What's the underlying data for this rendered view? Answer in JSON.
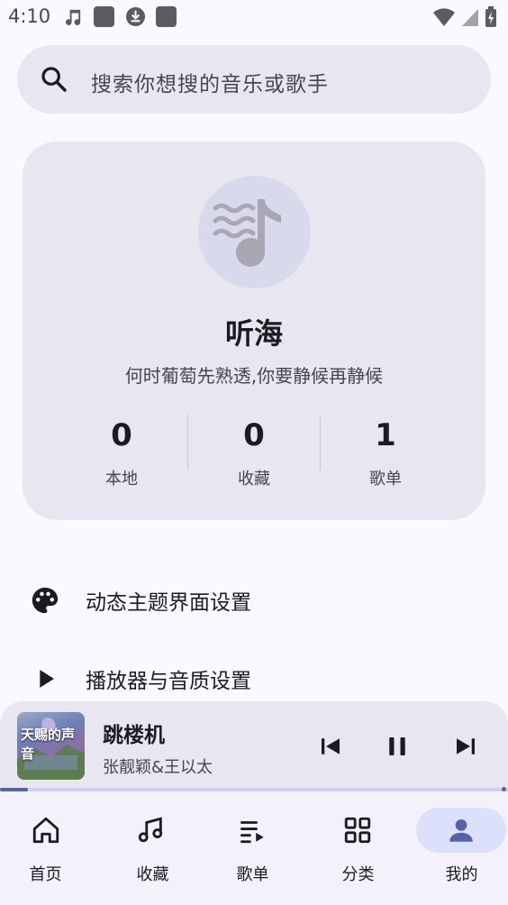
{
  "status_bar": {
    "time": "4:10",
    "left_icons": [
      "music-note-icon",
      "app-square-icon",
      "download-icon",
      "app-square-icon"
    ],
    "right_icons": [
      "wifi-icon",
      "cell-signal-icon",
      "battery-charging-icon"
    ]
  },
  "search": {
    "placeholder": "搜索你想搜的音乐或歌手",
    "icon": "search-icon"
  },
  "profile": {
    "name": "听海",
    "signature": "何时葡萄先熟透,你要静候再静候",
    "avatar_icon": "music-waves-icon",
    "stats": [
      {
        "value": "0",
        "label": "本地"
      },
      {
        "value": "0",
        "label": "收藏"
      },
      {
        "value": "1",
        "label": "歌单"
      }
    ]
  },
  "settings": [
    {
      "icon": "palette-icon",
      "label": "动态主题界面设置"
    },
    {
      "icon": "play-icon",
      "label": "播放器与音质设置"
    }
  ],
  "player": {
    "cover_text": "天赐的声音",
    "title": "跳楼机",
    "artist": "张靓颖&王以太",
    "progress": 0.055,
    "controls": [
      "skip-previous-icon",
      "pause-icon",
      "skip-next-icon"
    ]
  },
  "bottom_nav": {
    "active_index": 4,
    "items": [
      {
        "icon": "home-icon",
        "label": "首页"
      },
      {
        "icon": "music-note-icon",
        "label": "收藏"
      },
      {
        "icon": "playlist-icon",
        "label": "歌单"
      },
      {
        "icon": "grid-icon",
        "label": "分类"
      },
      {
        "icon": "person-icon",
        "label": "我的"
      }
    ]
  },
  "colors": {
    "background": "#fbf8ff",
    "surface": "#e8e6f0",
    "accent": "#5662a8",
    "active_pill": "#dce0fb",
    "text_primary": "#1b1b21",
    "text_secondary": "#46464f"
  }
}
